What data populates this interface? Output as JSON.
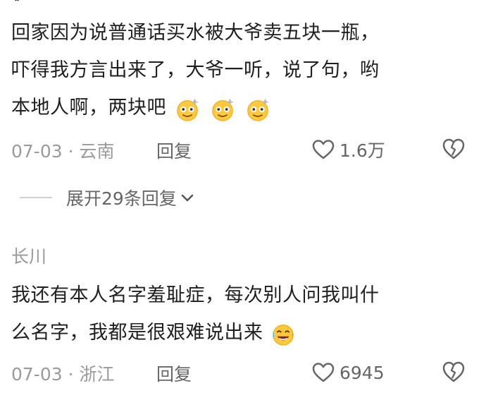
{
  "comments": [
    {
      "text_lines": [
        "回家因为说普通话买水被大爷卖五块一瓶，",
        "吓得我方言出来了，大爷一听，说了句，哟",
        "本地人啊，两块吧"
      ],
      "emojis": [
        "dizzy-smile-emoji",
        "dizzy-smile-emoji",
        "dizzy-smile-emoji"
      ],
      "date_location": "07-03 · 云南",
      "reply_label": "回复",
      "likes": "1.6万",
      "expand_replies_label": "展开29条回复"
    },
    {
      "username": "长川",
      "text_lines": [
        "我还有本人名字羞耻症，每次别人问我叫什",
        "么名字，我都是很艰难说出来"
      ],
      "emojis": [
        "laugh-cry-emoji"
      ],
      "date_location": "07-03 · 浙江",
      "reply_label": "回复",
      "likes": "6945"
    }
  ],
  "colors": {
    "text": "#1f1f1f",
    "meta": "#9a9a9a",
    "icon": "#666666",
    "divider": "#cfcfcf",
    "emoji_face": "#ffc83d"
  }
}
